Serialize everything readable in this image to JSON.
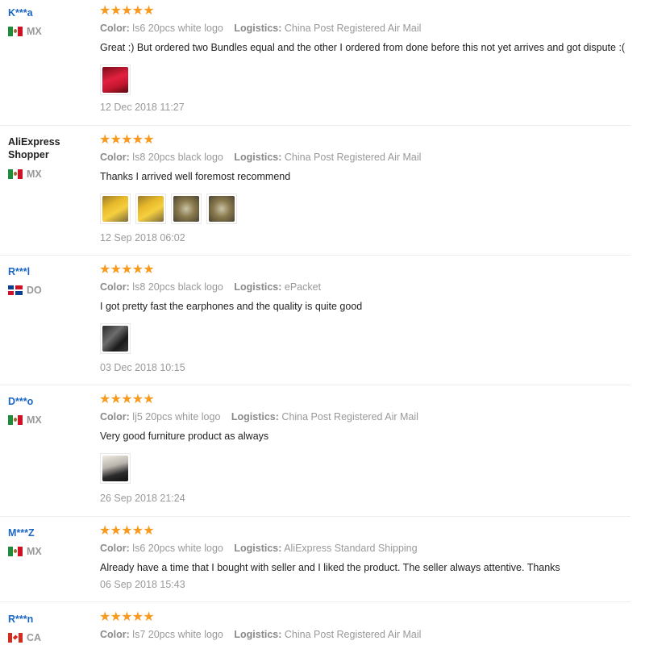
{
  "labels": {
    "color": "Color:",
    "logistics": "Logistics:"
  },
  "star_color": "#f79a1e",
  "reviews": [
    {
      "buyer": "K***a",
      "country": "MX",
      "flag": "mx-flag-icon",
      "rating": 5,
      "color": "ls6 20pcs white logo",
      "logistics": "China Post Registered Air Mail",
      "text": "Great :) But ordered two Bundles equal and the other I ordered from done before this not yet arrives and got dispute :(",
      "photos": [
        "red-package-photo"
      ],
      "date": "12 Dec 2018 11:27"
    },
    {
      "buyer": "AliExpress Shopper",
      "country": "MX",
      "flag": "mx-flag-icon",
      "rating": 5,
      "color": "ls8 20pcs black logo",
      "logistics": "China Post Registered Air Mail",
      "text": "Thanks I arrived well foremost recommend",
      "photos": [
        "yellow-package-photo",
        "yellow-package-photo",
        "earphones-photo",
        "earphones-photo"
      ],
      "date": "12 Sep 2018 06:02"
    },
    {
      "buyer": "R***l",
      "country": "DO",
      "flag": "do-flag-icon",
      "rating": 5,
      "color": "ls8 20pcs black logo",
      "logistics": "ePacket",
      "text": "I got pretty fast the earphones and the quality is quite good",
      "photos": [
        "black-earphones-photo"
      ],
      "date": "03 Dec 2018 10:15"
    },
    {
      "buyer": "D***o",
      "country": "MX",
      "flag": "mx-flag-icon",
      "rating": 5,
      "color": "lj5 20pcs white logo",
      "logistics": "China Post Registered Air Mail",
      "text": "Very good furniture product as always",
      "photos": [
        "earphones-bag-photo"
      ],
      "date": "26 Sep 2018 21:24"
    },
    {
      "buyer": "M***Z",
      "country": "MX",
      "flag": "mx-flag-icon",
      "rating": 5,
      "color": "ls6 20pcs white logo",
      "logistics": "AliExpress Standard Shipping",
      "text": "Already have a time that I bought with seller and I liked the product. The seller always attentive. Thanks",
      "photos": [],
      "date": "06 Sep 2018 15:43"
    },
    {
      "buyer": "R***n",
      "country": "CA",
      "flag": "ca-flag-icon",
      "rating": 5,
      "color": "ls7 20pcs white logo",
      "logistics": "China Post Registered Air Mail",
      "text": "",
      "photos": [],
      "date": ""
    }
  ]
}
